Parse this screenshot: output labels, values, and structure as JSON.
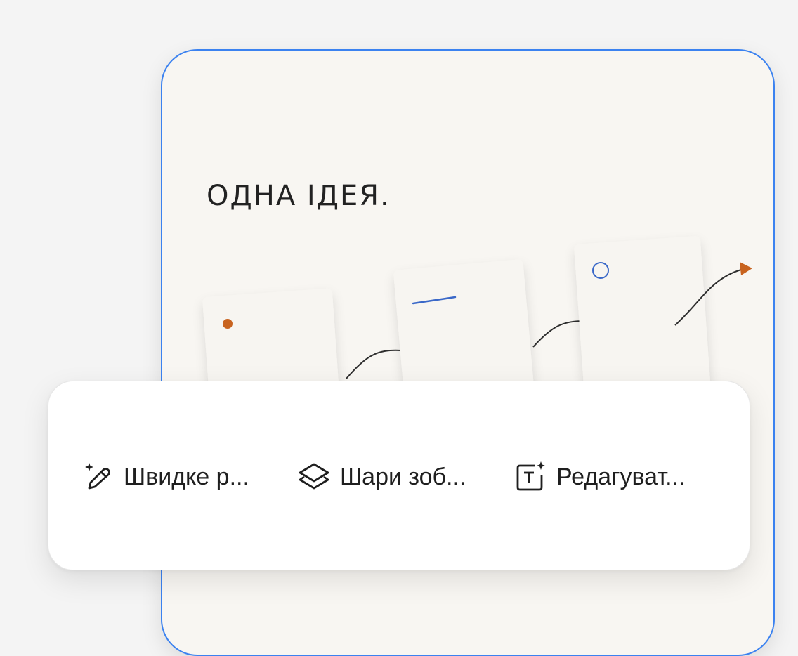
{
  "canvas": {
    "headline": "ОДНА ІДЕЯ.",
    "colors": {
      "border": "#3b82f0",
      "dot": "#c8631f",
      "arrow": "#c8631f",
      "line": "#3a68c8",
      "circle": "#3a68c8",
      "paper": "#f8f6f2"
    },
    "illustration_icons": [
      "orange-dot",
      "blue-line",
      "blue-circle",
      "connector-curve",
      "orange-arrow"
    ]
  },
  "toolbar": {
    "items": [
      {
        "label": "Швидке р...",
        "icon": "sparkle-pencil-icon"
      },
      {
        "label": "Шари зоб...",
        "icon": "layers-icon"
      },
      {
        "label": "Редагуват...",
        "icon": "text-sparkle-icon"
      }
    ]
  }
}
